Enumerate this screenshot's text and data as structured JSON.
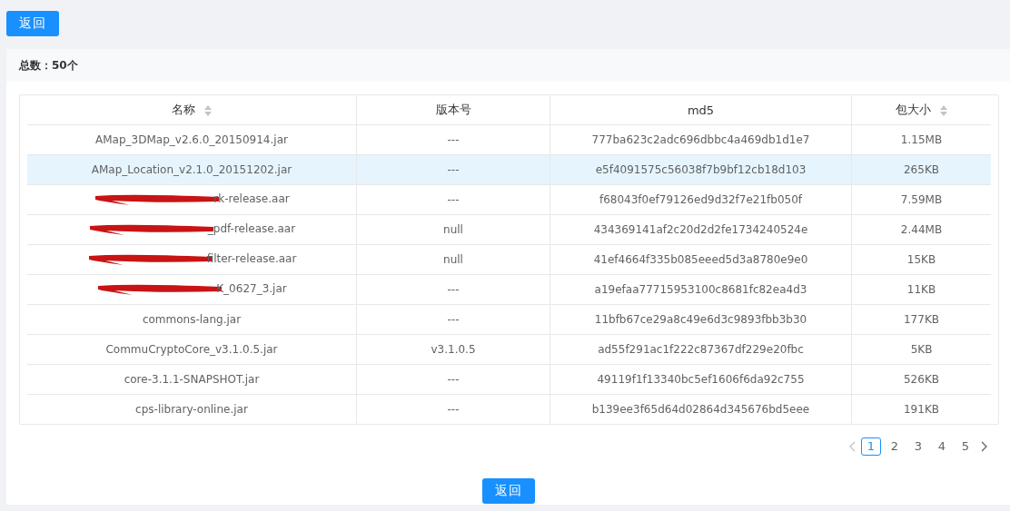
{
  "top_button": "返回",
  "summary": {
    "label": "总数：",
    "count": "50个"
  },
  "table": {
    "columns": [
      {
        "title": "名称",
        "sortable": true
      },
      {
        "title": "版本号",
        "sortable": false
      },
      {
        "title": "md5",
        "sortable": false
      },
      {
        "title": "包大小",
        "sortable": true
      }
    ],
    "rows": [
      {
        "name": "AMap_3DMap_v2.6.0_20150914.jar",
        "redacted": false,
        "version": "---",
        "md5": "777ba623c2adc696dbbc4a469db1d1e7",
        "size": "1.15MB",
        "selected": false
      },
      {
        "name": "AMap_Location_v2.1.0_20151202.jar",
        "redacted": false,
        "version": "---",
        "md5": "e5f4091575c56038f7b9bf12cb18d103",
        "size": "265KB",
        "selected": true
      },
      {
        "name": "rk-release.aar",
        "redacted": true,
        "version": "---",
        "md5": "f68043f0ef79126ed9d32f7e21fb050f",
        "size": "7.59MB",
        "selected": false
      },
      {
        "name": "_pdf-release.aar",
        "redacted": true,
        "version": "null",
        "md5": "434369141af2c20d2d2fe1734240524e",
        "size": "2.44MB",
        "selected": false
      },
      {
        "name": "filter-release.aar",
        "redacted": true,
        "version": "null",
        "md5": "41ef4664f335b085eeed5d3a8780e9e0",
        "size": "15KB",
        "selected": false
      },
      {
        "name": "K_0627_3.jar",
        "redacted": true,
        "version": "---",
        "md5": "a19efaa77715953100c8681fc82ea4d3",
        "size": "11KB",
        "selected": false
      },
      {
        "name": "commons-lang.jar",
        "redacted": false,
        "version": "---",
        "md5": "11bfb67ce29a8c49e6d3c9893fbb3b30",
        "size": "177KB",
        "selected": false
      },
      {
        "name": "CommuCryptoCore_v3.1.0.5.jar",
        "redacted": false,
        "version": "v3.1.0.5",
        "md5": "ad55f291ac1f222c87367df229e20fbc",
        "size": "5KB",
        "selected": false
      },
      {
        "name": "core-3.1.1-SNAPSHOT.jar",
        "redacted": false,
        "version": "---",
        "md5": "49119f1f13340bc5ef1606f6da92c755",
        "size": "526KB",
        "selected": false
      },
      {
        "name": "cps-library-online.jar",
        "redacted": false,
        "version": "---",
        "md5": "b139ee3f65d64d02864d345676bd5eee",
        "size": "191KB",
        "selected": false
      }
    ]
  },
  "pagination": {
    "pages": [
      {
        "label": "1",
        "selected": true
      },
      {
        "label": "2",
        "selected": false
      },
      {
        "label": "3",
        "selected": false
      },
      {
        "label": "4",
        "selected": false
      },
      {
        "label": "5",
        "selected": false
      }
    ]
  },
  "bottom_button": "返回"
}
